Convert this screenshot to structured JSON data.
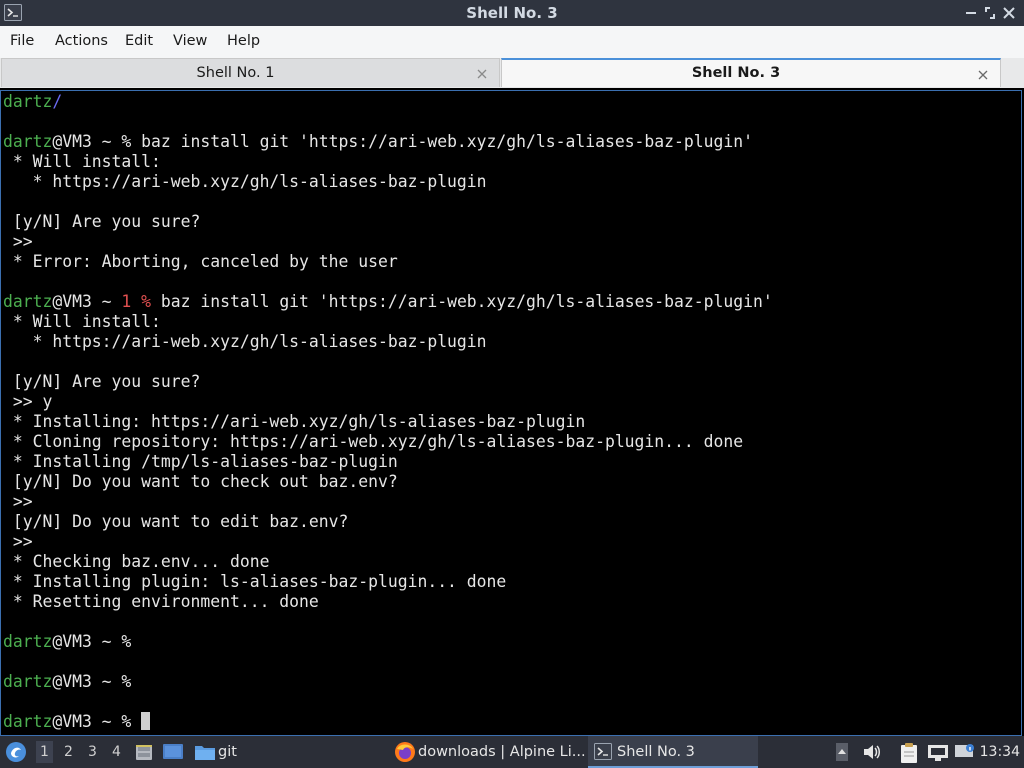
{
  "window": {
    "title": "Shell No. 3"
  },
  "menu": {
    "items": [
      "File",
      "Actions",
      "Edit",
      "View",
      "Help"
    ]
  },
  "tabs": [
    {
      "label": "Shell No. 1",
      "active": false
    },
    {
      "label": "Shell No. 3",
      "active": true
    }
  ],
  "terminal": {
    "lines": [
      [
        {
          "t": "dartz",
          "c": "user"
        },
        {
          "t": "/",
          "c": "path"
        }
      ],
      [],
      [
        {
          "t": "dartz",
          "c": "user"
        },
        {
          "t": "@VM3 ~ % baz install git 'https://ari-web.xyz/gh/ls-aliases-baz-plugin'"
        }
      ],
      [
        {
          "t": " * Will install:"
        }
      ],
      [
        {
          "t": "   * https://ari-web.xyz/gh/ls-aliases-baz-plugin"
        }
      ],
      [],
      [
        {
          "t": " [y/N] Are you sure?"
        }
      ],
      [
        {
          "t": " >>"
        }
      ],
      [
        {
          "t": " * Error: Aborting, canceled by the user"
        }
      ],
      [],
      [
        {
          "t": "dartz",
          "c": "user"
        },
        {
          "t": "@VM3 ~ "
        },
        {
          "t": "1 %",
          "c": "err"
        },
        {
          "t": " baz install git 'https://ari-web.xyz/gh/ls-aliases-baz-plugin'"
        }
      ],
      [
        {
          "t": " * Will install:"
        }
      ],
      [
        {
          "t": "   * https://ari-web.xyz/gh/ls-aliases-baz-plugin"
        }
      ],
      [],
      [
        {
          "t": " [y/N] Are you sure?"
        }
      ],
      [
        {
          "t": " >> y"
        }
      ],
      [
        {
          "t": " * Installing: https://ari-web.xyz/gh/ls-aliases-baz-plugin"
        }
      ],
      [
        {
          "t": " * Cloning repository: https://ari-web.xyz/gh/ls-aliases-baz-plugin... done"
        }
      ],
      [
        {
          "t": " * Installing /tmp/ls-aliases-baz-plugin"
        }
      ],
      [
        {
          "t": " [y/N] Do you want to check out baz.env?"
        }
      ],
      [
        {
          "t": " >>"
        }
      ],
      [
        {
          "t": " [y/N] Do you want to edit baz.env?"
        }
      ],
      [
        {
          "t": " >>"
        }
      ],
      [
        {
          "t": " * Checking baz.env... done"
        }
      ],
      [
        {
          "t": " * Installing plugin: ls-aliases-baz-plugin... done"
        }
      ],
      [
        {
          "t": " * Resetting environment... done"
        }
      ],
      [],
      [
        {
          "t": "dartz",
          "c": "user"
        },
        {
          "t": "@VM3 ~ %"
        }
      ],
      [],
      [
        {
          "t": "dartz",
          "c": "user"
        },
        {
          "t": "@VM3 ~ %"
        }
      ],
      [],
      [
        {
          "t": "dartz",
          "c": "user"
        },
        {
          "t": "@VM3 ~ % "
        },
        {
          "t": "",
          "c": "cursor"
        }
      ]
    ]
  },
  "taskbar": {
    "workspaces": [
      "1",
      "2",
      "3",
      "4"
    ],
    "active_workspace": "1",
    "folder_label": "git",
    "tasks": [
      {
        "label": "downloads | Alpine Li...",
        "icon": "firefox-icon",
        "active": false
      },
      {
        "label": "Shell No. 3",
        "icon": "terminal-icon",
        "active": true
      }
    ],
    "clock": "13:34"
  },
  "colors": {
    "titlebar": "#2f343f",
    "terminal_bg": "#000000",
    "prompt_user": "#4caf50",
    "path": "#6a6af0",
    "error_status": "#e05050",
    "taskbar": "#2b2e37"
  }
}
